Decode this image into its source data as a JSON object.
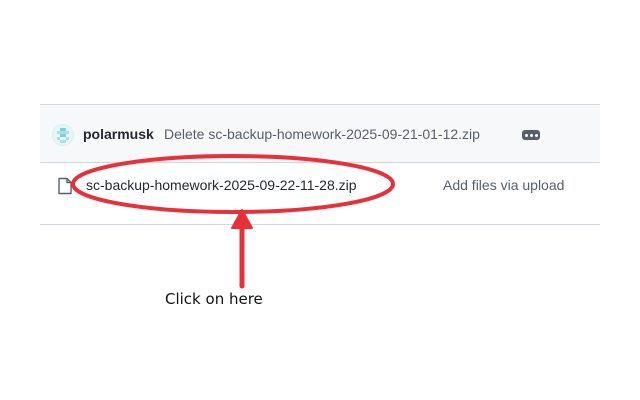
{
  "commit": {
    "author": "polarmusk",
    "message": "Delete sc-backup-homework-2025-09-21-01-12.zip"
  },
  "files": [
    {
      "name": "sc-backup-homework-2025-09-22-11-28.zip",
      "last_commit": "Add files via upload"
    }
  ],
  "annotation": {
    "text": "Click on here",
    "color": "#e8303a"
  },
  "icons": {
    "avatar": "pixel-avatar-icon",
    "more": "ellipsis-icon",
    "file": "file-icon"
  }
}
